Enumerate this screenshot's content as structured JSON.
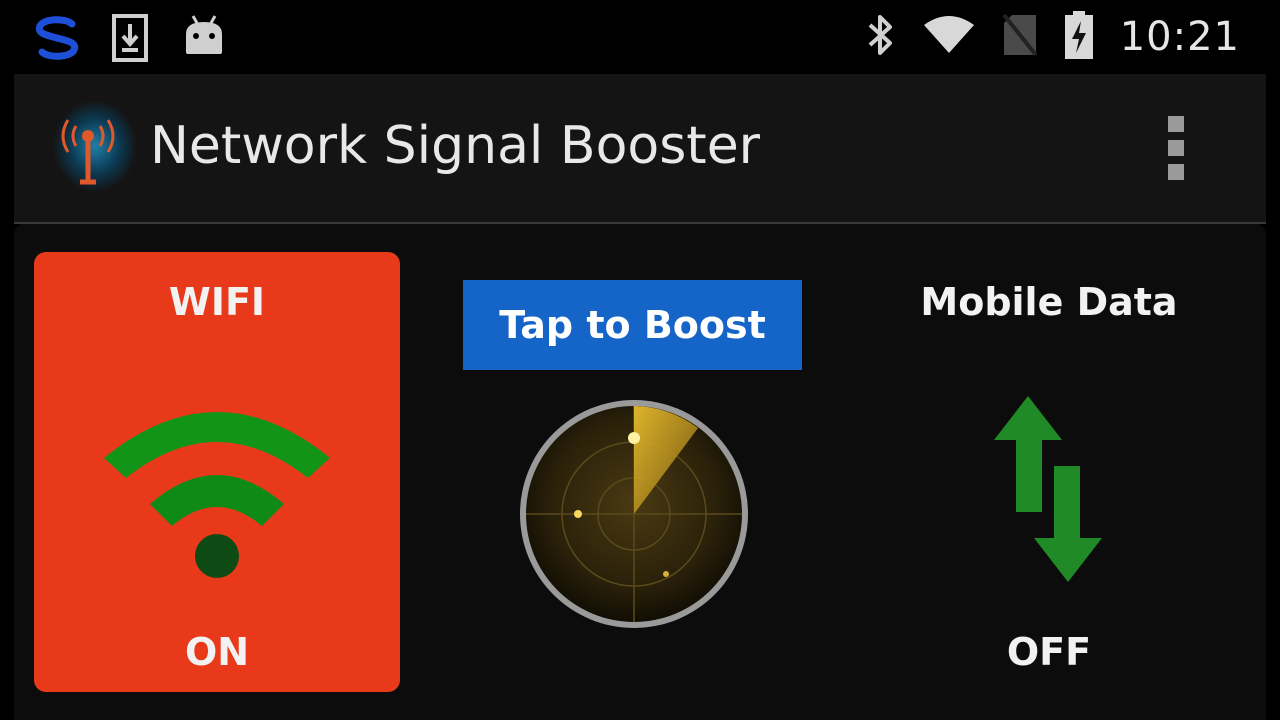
{
  "status_bar": {
    "time": "10:21",
    "left_icons": [
      "app-s-icon",
      "download-icon",
      "android-icon"
    ],
    "right_icons": [
      "bluetooth-icon",
      "wifi-signal-icon",
      "no-sim-icon",
      "battery-charging-icon"
    ]
  },
  "action_bar": {
    "title": "Network Signal Booster",
    "app_icon": "signal-tower-icon",
    "menu_icon": "overflow-menu-icon"
  },
  "wifi": {
    "label": "WIFI",
    "state": "ON",
    "color": "#e83a1a",
    "icon": "wifi-icon"
  },
  "boost": {
    "label": "Tap to Boost",
    "color": "#1565c8",
    "icon": "radar-icon"
  },
  "mobile_data": {
    "label": "Mobile Data",
    "state": "OFF",
    "icon": "data-transfer-arrows-icon"
  }
}
